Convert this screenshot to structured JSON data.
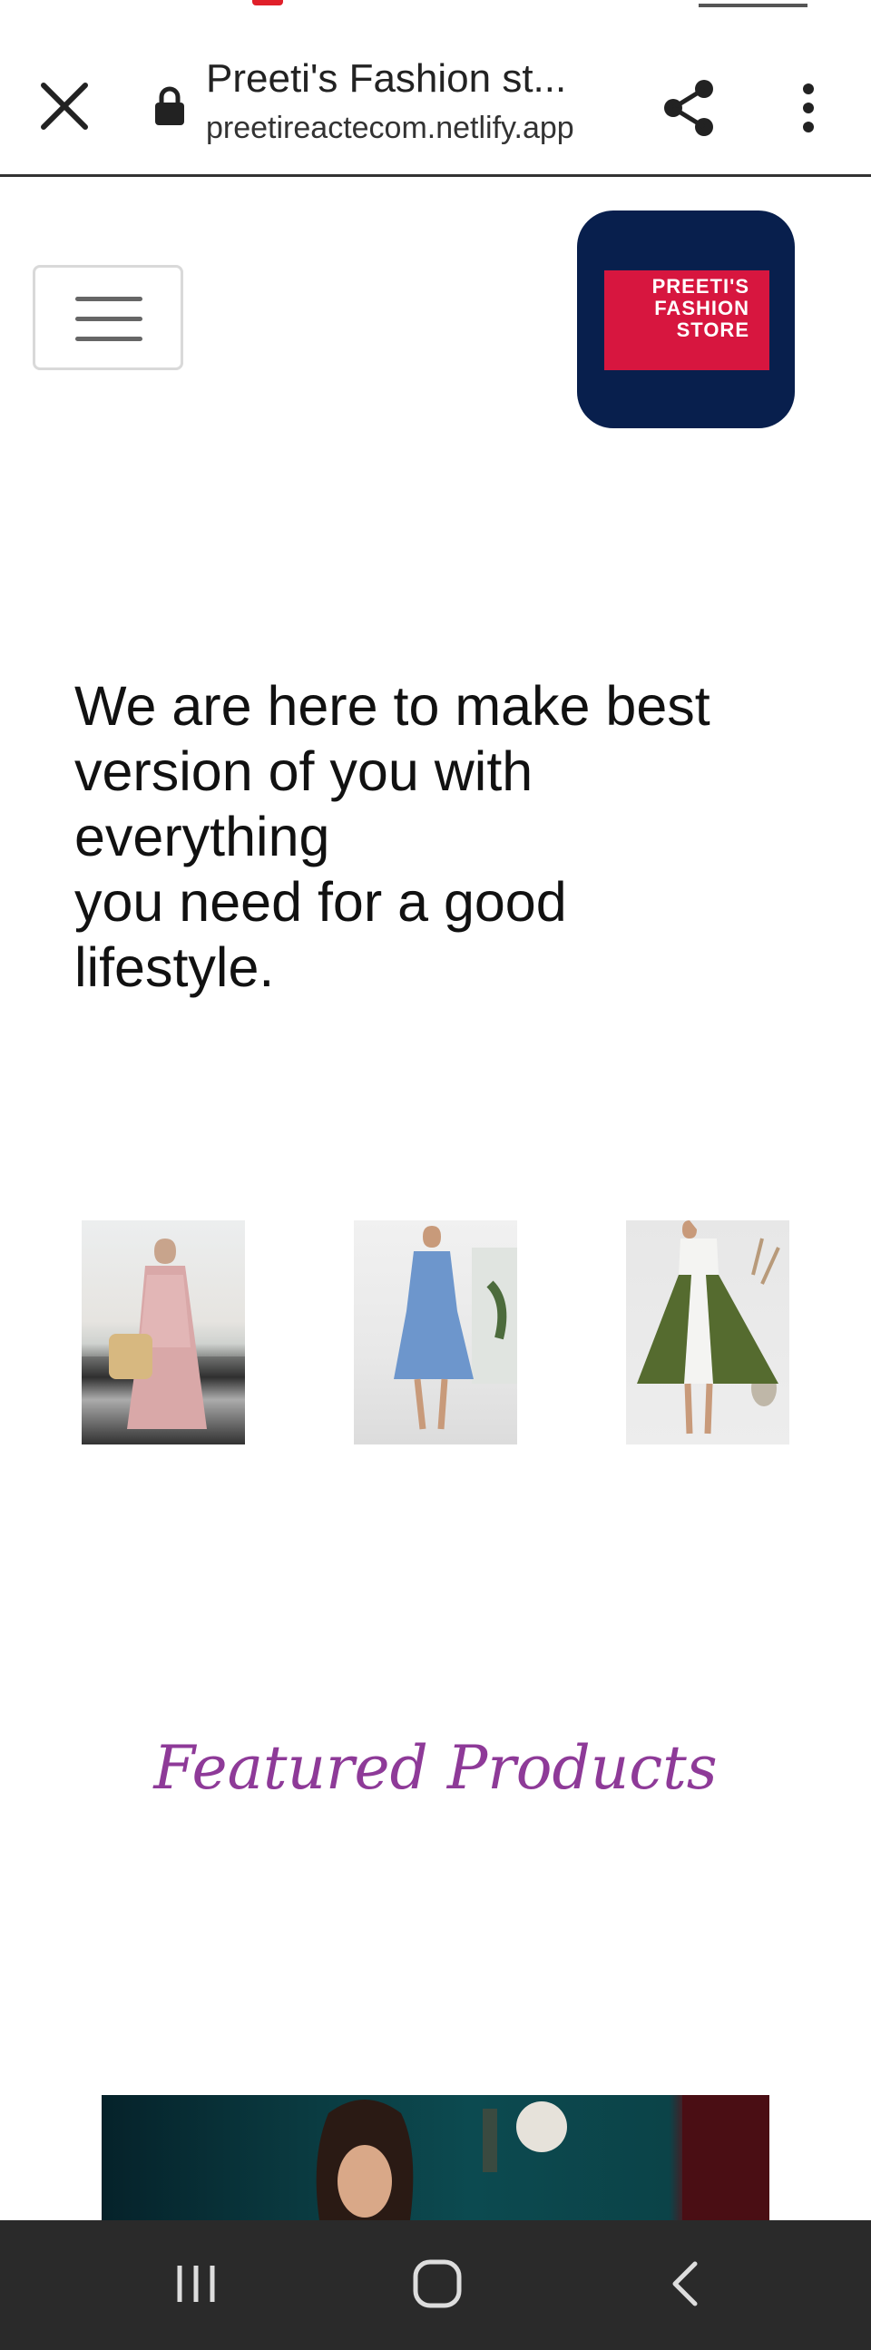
{
  "browser": {
    "page_title": "Preeti's Fashion st...",
    "url": "preetireactecom.netlify.app",
    "close_icon": "close-icon",
    "lock_icon": "lock-icon",
    "share_icon": "share-icon",
    "menu_icon": "more-vert-icon"
  },
  "header": {
    "menu_icon": "hamburger-menu-icon",
    "logo_text": "PREETI'S\nFASHION\nSTORE",
    "logo_bg": "#081f4d",
    "logo_accent": "#d7163f"
  },
  "hero": {
    "lines": [
      "We are here to make best",
      "version of you with",
      "everything",
      "you need for a good",
      "lifestyle."
    ]
  },
  "gallery": {
    "images": [
      "pink-boho-maxi-dress",
      "blue-floral-midi-dress",
      "olive-white-flare-dress"
    ]
  },
  "featured": {
    "heading": "Featured Products",
    "color": "#8e3a98"
  },
  "nav": {
    "recent_icon": "recent-apps-icon",
    "home_icon": "home-icon",
    "back_icon": "back-icon"
  }
}
